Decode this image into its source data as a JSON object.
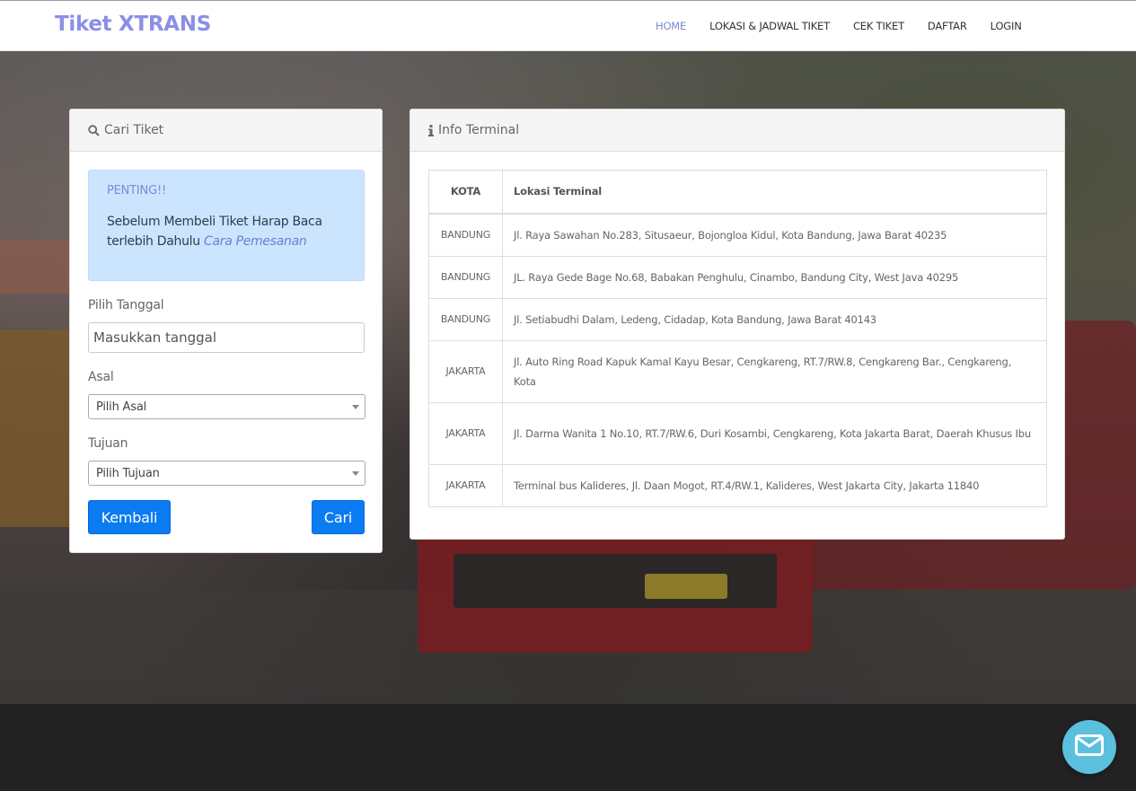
{
  "brand": "Tiket XTRANS",
  "nav": {
    "items": [
      {
        "label": "HOME",
        "active": true
      },
      {
        "label": "LOKASI & JADWAL TIKET",
        "active": false
      },
      {
        "label": "CEK TIKET",
        "active": false
      },
      {
        "label": "DAFTAR",
        "active": false
      },
      {
        "label": "LOGIN",
        "active": false
      }
    ]
  },
  "search_panel": {
    "heading": "Cari Tiket",
    "alert": {
      "title": "PENTING!!",
      "text": "Sebelum Membeli Tiket Harap Baca terlebih Dahulu",
      "link": "Cara Pemesanan"
    },
    "date_label": "Pilih Tanggal",
    "date_placeholder": "Masukkan tanggal",
    "origin_label": "Asal",
    "origin_value": "Pilih Asal",
    "dest_label": "Tujuan",
    "dest_value": "Pilih Tujuan",
    "back_button": "Kembali",
    "search_button": "Cari"
  },
  "info_panel": {
    "heading": "Info Terminal",
    "columns": [
      "KOTA",
      "Lokasi Terminal"
    ],
    "rows": [
      {
        "city": "BANDUNG",
        "address": "Jl. Raya Sawahan No.283, Situsaeur, Bojongloa Kidul, Kota Bandung, Jawa Barat 40235"
      },
      {
        "city": "BANDUNG",
        "address": "JL. Raya Gede Bage No.68, Babakan Penghulu, Cinambo, Bandung City, West Java 40295"
      },
      {
        "city": "BANDUNG",
        "address": "Jl. Setiabudhi Dalam, Ledeng, Cidadap, Kota Bandung, Jawa Barat 40143"
      },
      {
        "city": "JAKARTA",
        "address": "Jl. Auto Ring Road Kapuk Kamal Kayu Besar, Cengkareng, RT.7/RW.8, Cengkareng Bar., Cengkareng, Kota"
      },
      {
        "city": "JAKARTA",
        "address": "Jl. Darma Wanita 1 No.10, RT.7/RW.6, Duri Kosambi, Cengkareng, Kota Jakarta Barat, Daerah Khusus Ibu"
      },
      {
        "city": "JAKARTA",
        "address": "Terminal bus Kalideres, Jl. Daan Mogot, RT.4/RW.1, Kalideres, West Jakarta City, Jakarta 11840"
      }
    ]
  },
  "icons": {
    "search": "search-icon",
    "info": "info-icon",
    "chat": "envelope-icon"
  },
  "colors": {
    "brand": "#8a90e6",
    "nav_active": "#7b8ad6",
    "primary_button": "#0a7bf0",
    "alert_bg": "#cce5ff",
    "chat_button": "#5bc0de",
    "footer": "#222222"
  }
}
